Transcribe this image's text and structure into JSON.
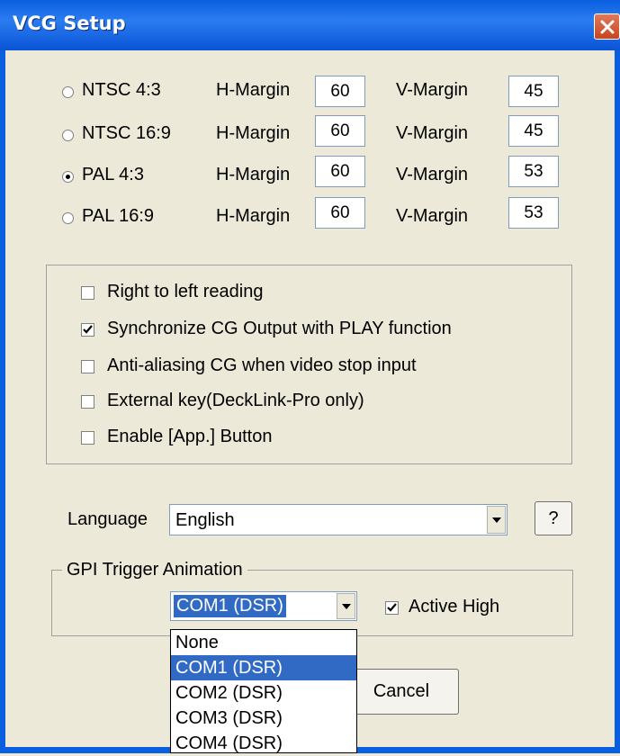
{
  "window": {
    "title": "VCG Setup"
  },
  "formats": [
    {
      "label": "NTSC 4:3",
      "selected": false,
      "h_label": "H-Margin",
      "h_value": "60",
      "v_label": "V-Margin",
      "v_value": "45"
    },
    {
      "label": "NTSC 16:9",
      "selected": false,
      "h_label": "H-Margin",
      "h_value": "60",
      "v_label": "V-Margin",
      "v_value": "45"
    },
    {
      "label": "PAL 4:3",
      "selected": true,
      "h_label": "H-Margin",
      "h_value": "60",
      "v_label": "V-Margin",
      "v_value": "53"
    },
    {
      "label": "PAL 16:9",
      "selected": false,
      "h_label": "H-Margin",
      "h_value": "60",
      "v_label": "V-Margin",
      "v_value": "53"
    }
  ],
  "options": [
    {
      "label": "Right to left reading",
      "checked": false
    },
    {
      "label": "Synchronize CG Output with PLAY function",
      "checked": true
    },
    {
      "label": "Anti-aliasing CG when video stop input",
      "checked": false
    },
    {
      "label": "External key(DeckLink-Pro only)",
      "checked": false
    },
    {
      "label": "Enable [App.] Button",
      "checked": false
    }
  ],
  "language": {
    "label": "Language",
    "value": "English",
    "help_label": "?"
  },
  "gpi": {
    "group_label": "GPI Trigger Animation",
    "port_value": "COM1 (DSR)",
    "active_high_label": "Active High",
    "active_high_checked": true,
    "dropdown_options": [
      "None",
      "COM1 (DSR)",
      "COM2 (DSR)",
      "COM3 (DSR)",
      "COM4 (DSR)"
    ],
    "dropdown_selected": "COM1 (DSR)"
  },
  "buttons": {
    "cancel_label": "Cancel"
  },
  "colors": {
    "titlebar": "#0a5fe0",
    "dialog_bg": "#ece9d8",
    "selection": "#316ac5"
  }
}
